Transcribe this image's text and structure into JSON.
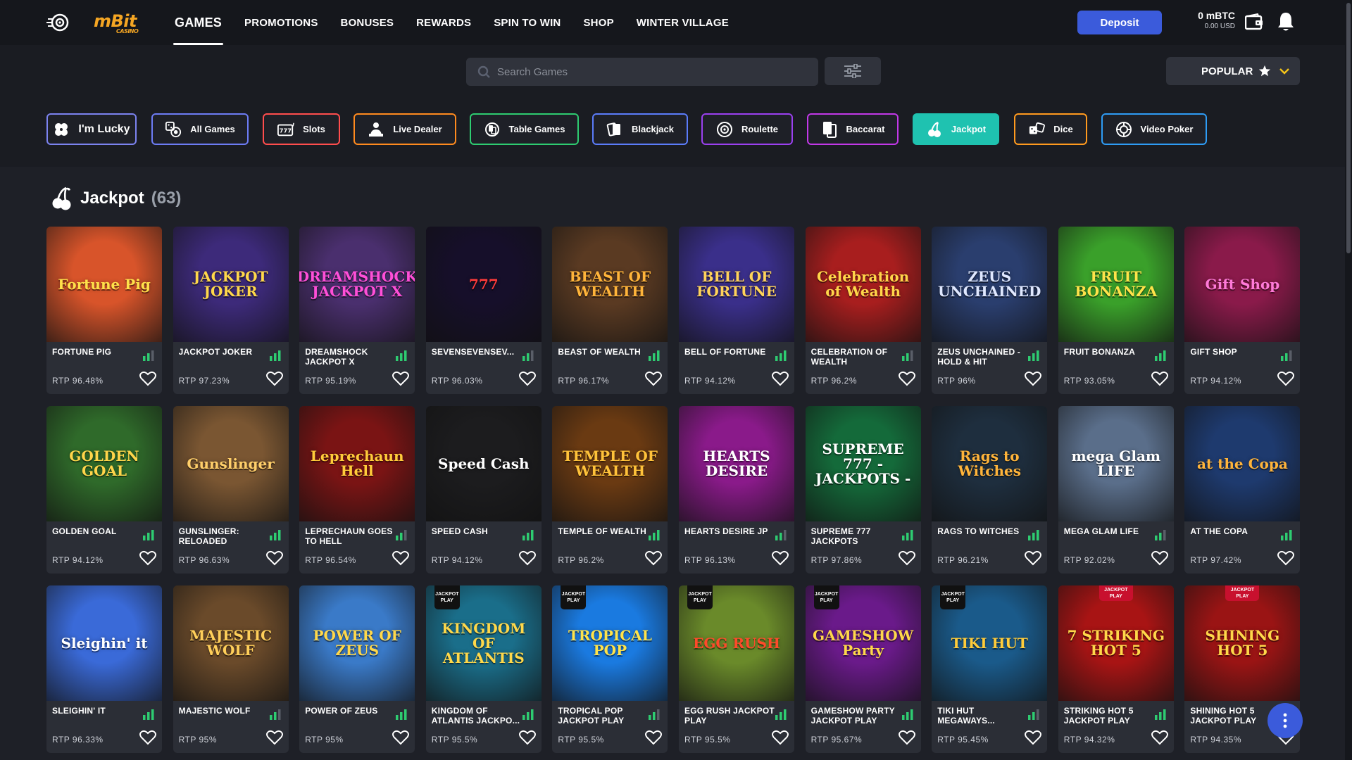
{
  "nav": {
    "logo": "mBit",
    "logo_sub": "CASINO",
    "items": [
      {
        "label": "GAMES",
        "active": true
      },
      {
        "label": "PROMOTIONS"
      },
      {
        "label": "BONUSES"
      },
      {
        "label": "REWARDS"
      },
      {
        "label": "SPIN TO WIN"
      },
      {
        "label": "SHOP"
      },
      {
        "label": "WINTER VILLAGE"
      }
    ],
    "deposit_label": "Deposit",
    "balance_btc": "0 mBTC",
    "balance_usd": "0.00 USD"
  },
  "search": {
    "placeholder": "Search Games",
    "value": ""
  },
  "sort": {
    "label": "POPULAR"
  },
  "categories": [
    {
      "label": "I'm Lucky",
      "color": "#7c83f0",
      "icon": "clover-icon"
    },
    {
      "label": "All Games",
      "color": "#6d7cf5",
      "icon": "dice-chips-icon"
    },
    {
      "label": "Slots",
      "color": "#ff4d4d",
      "icon": "slot-777-icon"
    },
    {
      "label": "Live Dealer",
      "color": "#ff8a1e",
      "icon": "dealer-icon"
    },
    {
      "label": "Table Games",
      "color": "#2ecc71",
      "icon": "table-games-icon"
    },
    {
      "label": "Blackjack",
      "color": "#5b7cfa",
      "icon": "cards-icon"
    },
    {
      "label": "Roulette",
      "color": "#9b40f0",
      "icon": "roulette-icon"
    },
    {
      "label": "Baccarat",
      "color": "#c238e8",
      "icon": "baccarat-icon"
    },
    {
      "label": "Jackpot",
      "color": "#1fc2b0",
      "icon": "cherry-icon",
      "active": true
    },
    {
      "label": "Dice",
      "color": "#ff9a1e",
      "icon": "dice-icon"
    },
    {
      "label": "Video Poker",
      "color": "#2e9cf5",
      "icon": "chip-icon"
    }
  ],
  "section": {
    "title": "Jackpot",
    "count": "(63)"
  },
  "games": [
    {
      "name": "FORTUNE PIG",
      "rtp": "RTP 96.48%",
      "art": "Fortune Pig",
      "bg": "#d8542a",
      "fg": "#ffe14a"
    },
    {
      "name": "JACKPOT JOKER",
      "rtp": "RTP 97.23%",
      "art": "JACKPOT JOKER",
      "bg": "#3d2a7a",
      "fg": "#ffd84a"
    },
    {
      "name": "DREAMSHOCK JACKPOT X",
      "rtp": "RTP 95.19%",
      "art": "DREAMSHOCK JACKPOT X",
      "bg": "#4a2f6e",
      "fg": "#ff4fd8"
    },
    {
      "name": "SEVENSEVENSEV...",
      "rtp": "RTP 96.03%",
      "art": "777",
      "bg": "#160f2a",
      "fg": "#ff3b3b"
    },
    {
      "name": "BEAST OF WEALTH",
      "rtp": "RTP 96.17%",
      "art": "BEAST OF WEALTH",
      "bg": "#5a3a22",
      "fg": "#ffb43a"
    },
    {
      "name": "BELL OF FORTUNE",
      "rtp": "RTP 94.12%",
      "art": "BELL OF FORTUNE",
      "bg": "#3a2f8a",
      "fg": "#ffd35a"
    },
    {
      "name": "CELEBRATION OF WEALTH",
      "rtp": "RTP 96.2%",
      "art": "Celebration of Wealth",
      "bg": "#a81e1e",
      "fg": "#ffd64a"
    },
    {
      "name": "ZEUS UNCHAINED - HOLD & HIT",
      "rtp": "RTP 96%",
      "art": "ZEUS UNCHAINED",
      "bg": "#2a3e6e",
      "fg": "#e0e8ff"
    },
    {
      "name": "FRUIT BONANZA",
      "rtp": "RTP 93.05%",
      "art": "FRUIT BONANZA",
      "bg": "#3aa02a",
      "fg": "#ffe34a"
    },
    {
      "name": "GIFT SHOP",
      "rtp": "RTP 94.12%",
      "art": "Gift Shop",
      "bg": "#8a1a4a",
      "fg": "#ff7ad8"
    },
    {
      "name": "GOLDEN GOAL",
      "rtp": "RTP 94.12%",
      "art": "GOLDEN GOAL",
      "bg": "#2f6a2a",
      "fg": "#ffd54a"
    },
    {
      "name": "GUNSLINGER: RELOADED",
      "rtp": "RTP 96.63%",
      "art": "Gunslinger",
      "bg": "#7a5632",
      "fg": "#ffcf6a"
    },
    {
      "name": "LEPRECHAUN GOES TO HELL",
      "rtp": "RTP 96.54%",
      "art": "Leprechaun Hell",
      "bg": "#7a1414",
      "fg": "#ffcc3a"
    },
    {
      "name": "SPEED CASH",
      "rtp": "RTP 94.12%",
      "art": "Speed Cash",
      "bg": "#1c1c1e",
      "fg": "#ffffff"
    },
    {
      "name": "TEMPLE OF WEALTH",
      "rtp": "RTP 96.2%",
      "art": "TEMPLE OF WEALTH",
      "bg": "#6a3a12",
      "fg": "#ffc23a"
    },
    {
      "name": "HEARTS DESIRE JP",
      "rtp": "RTP 96.13%",
      "art": "HEARTS DESIRE",
      "bg": "#8a1a8a",
      "fg": "#ffffff"
    },
    {
      "name": "SUPREME 777 JACKPOTS",
      "rtp": "RTP 97.86%",
      "art": "SUPREME 777 - JACKPOTS -",
      "bg": "#146a3a",
      "fg": "#ffffff"
    },
    {
      "name": "RAGS TO WITCHES",
      "rtp": "RTP 96.21%",
      "art": "Rags to Witches",
      "bg": "#1e2e3e",
      "fg": "#ffb43a"
    },
    {
      "name": "MEGA GLAM LIFE",
      "rtp": "RTP 92.02%",
      "art": "mega Glam LIFE",
      "bg": "#5a6e8a",
      "fg": "#ffffff"
    },
    {
      "name": "AT THE COPA",
      "rtp": "RTP 97.42%",
      "art": "at the Copa",
      "bg": "#1e3a6e",
      "fg": "#ffb43a"
    },
    {
      "name": "SLEIGHIN' IT",
      "rtp": "RTP 96.33%",
      "art": "Sleighin' it",
      "bg": "#3a6ad8",
      "fg": "#ffffff"
    },
    {
      "name": "MAJESTIC WOLF",
      "rtp": "RTP 95%",
      "art": "MAJESTIC WOLF",
      "bg": "#6a4a2a",
      "fg": "#ffcf5a"
    },
    {
      "name": "POWER OF ZEUS",
      "rtp": "RTP 95%",
      "art": "POWER OF ZEUS",
      "bg": "#3a7ac8",
      "fg": "#ffd84a"
    },
    {
      "name": "KINGDOM OF ATLANTIS JACKPO...",
      "rtp": "RTP 95.5%",
      "art": "KINGDOM OF ATLANTIS",
      "bg": "#1a6e8a",
      "fg": "#ffd84a",
      "jackpot_play": true
    },
    {
      "name": "TROPICAL POP JACKPOT PLAY",
      "rtp": "RTP 95.5%",
      "art": "TROPICAL POP",
      "bg": "#1a7ae0",
      "fg": "#ffe34a",
      "jackpot_play": true
    },
    {
      "name": "EGG RUSH JACKPOT PLAY",
      "rtp": "RTP 95.5%",
      "art": "EGG RUSH",
      "bg": "#6a8a2a",
      "fg": "#ff4a2a",
      "jackpot_play": true
    },
    {
      "name": "GAMESHOW PARTY JACKPOT PLAY",
      "rtp": "RTP 95.67%",
      "art": "GAMESHOW Party",
      "bg": "#6a1a8a",
      "fg": "#ffd84a",
      "jackpot_play": true
    },
    {
      "name": "TIKI HUT MEGAWAYS...",
      "rtp": "RTP 95.45%",
      "art": "TIKI HUT",
      "bg": "#1a5a8a",
      "fg": "#ffcc3a",
      "jackpot_play": true
    },
    {
      "name": "STRIKING HOT 5 JACKPOT PLAY",
      "rtp": "RTP 94.32%",
      "art": "7 STRIKING HOT 5",
      "bg": "#a81414",
      "fg": "#ffd84a",
      "jackpot_play_top": true
    },
    {
      "name": "SHINING HOT 5 JACKPOT PLAY",
      "rtp": "RTP 94.35%",
      "art": "SHINING HOT 5",
      "bg": "#9a1414",
      "fg": "#ffd84a",
      "jackpot_play_top": true
    }
  ],
  "jackpot_badge": "JACKPOT PLAY"
}
